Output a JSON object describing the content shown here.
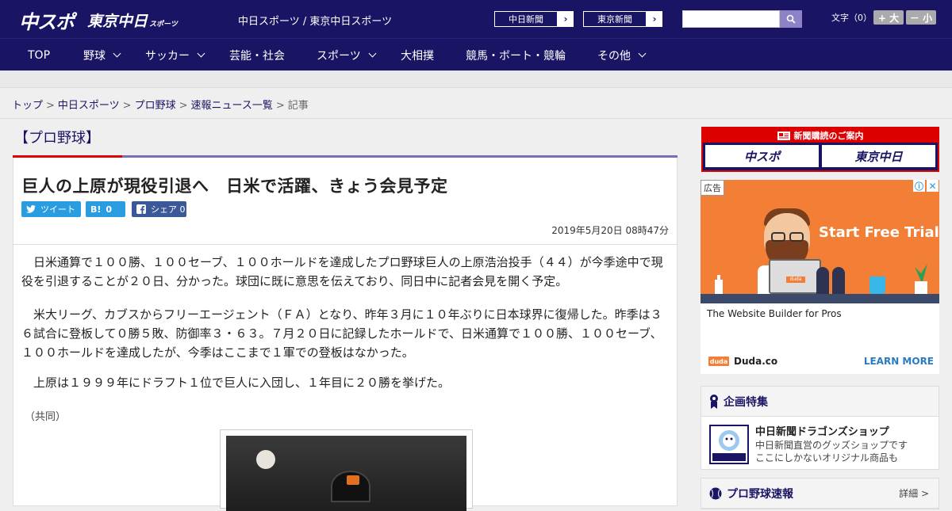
{
  "header": {
    "logo_main": "中スポ",
    "logo_tokyo": "東京中日",
    "logo_tokyo_small": "スポーツ",
    "site_title": "中日スポーツ / 東京中日スポーツ",
    "paper_links": [
      "中日新聞",
      "東京新聞"
    ],
    "font_size_label": "文字（0）",
    "font_larger": "+ 大",
    "font_smaller": "－ 小"
  },
  "nav": {
    "items": [
      {
        "label": "TOP",
        "dropdown": false
      },
      {
        "label": "野球",
        "dropdown": true
      },
      {
        "label": "サッカー",
        "dropdown": true
      },
      {
        "label": "芸能・社会",
        "dropdown": false
      },
      {
        "label": "スポーツ",
        "dropdown": true
      },
      {
        "label": "大相撲",
        "dropdown": false
      },
      {
        "label": "競馬・ボート・競輪",
        "dropdown": false
      },
      {
        "label": "その他",
        "dropdown": true
      }
    ]
  },
  "breadcrumb": {
    "items": [
      "トップ",
      "中日スポーツ",
      "プロ野球",
      "速報ニュース一覧"
    ],
    "current": "記事",
    "separator": ">"
  },
  "article": {
    "category": "【プロ野球】",
    "headline": "巨人の上原が現役引退へ　日米で活躍、きょう会見予定",
    "share": {
      "tweet": "ツイート",
      "hatena_icon": "B!",
      "hatena_count": "0",
      "facebook": "シェア",
      "facebook_count": "0"
    },
    "date": "2019年5月20日 08時47分",
    "paragraphs": [
      "日米通算で１００勝、１００セーブ、１００ホールドを達成したプロ野球巨人の上原浩治投手（４４）が今季途中で現役を引退することが２０日、分かった。球団に既に意思を伝えており、同日中に記者会見を開く予定。",
      "米大リーグ、カブスからフリーエージェント（ＦＡ）となり、昨年３月に１０年ぶりに日本球界に復帰した。昨季は３６試合に登板して０勝５敗、防御率３・６３。７月２０日に記録したホールドで、日米通算で１００勝、１００セーブ、１００ホールドを達成したが、今季はここまで１軍での登板はなかった。",
      "上原は１９９９年にドラフト１位で巨人に入団し、１年目に２０勝を挙げた。"
    ],
    "source": "（共同）"
  },
  "sidebar": {
    "subscribe": {
      "heading": "新聞購読のご案内",
      "logos": [
        "中スポ",
        "東京中日"
      ]
    },
    "ad": {
      "label": "広告",
      "cta": "Start Free Trial",
      "tagline": "The Website Builder for Pros",
      "brand_icon": "duda",
      "brand": "Duda.co",
      "learn_more": "LEARN MORE"
    },
    "feature": {
      "heading": "企画特集",
      "title": "中日新聞ドラゴンズショップ",
      "desc_lines": [
        "中日新聞直営のグッズショップです",
        "ここにしかないオリジナル商品も"
      ]
    },
    "baseball": {
      "heading": "プロ野球速報",
      "more": "詳細 >"
    }
  },
  "colors": {
    "brand_navy": "#1a1464",
    "accent_red": "#dd0000",
    "twitter": "#2a9de0",
    "facebook": "#3b5998",
    "ad_orange": "#f27f35"
  }
}
